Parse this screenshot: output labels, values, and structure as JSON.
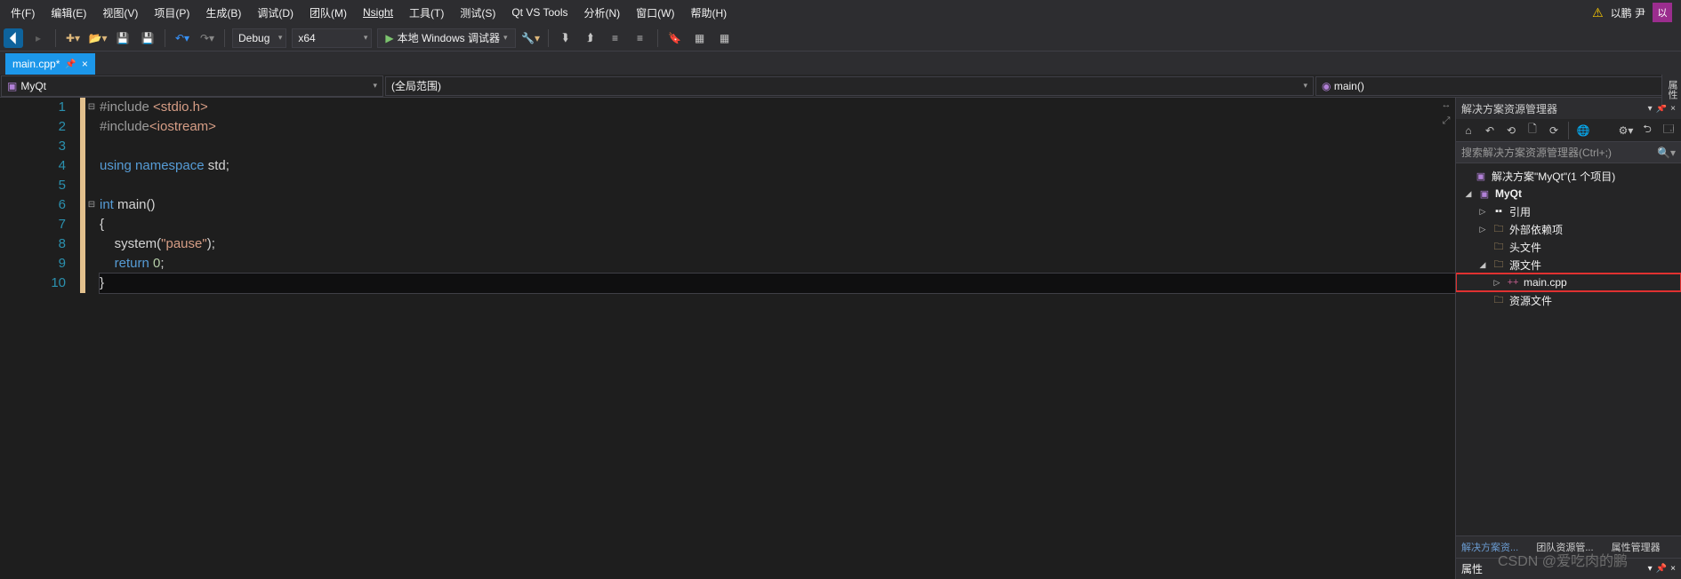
{
  "menu": {
    "file": "件(F)",
    "edit": "编辑(E)",
    "view": "视图(V)",
    "project": "项目(P)",
    "build": "生成(B)",
    "debug": "调试(D)",
    "team": "团队(M)",
    "nsight": "Nsight",
    "tools": "工具(T)",
    "test": "测试(S)",
    "qt": "Qt VS Tools",
    "analyze": "分析(N)",
    "window": "窗口(W)",
    "help": "帮助(H)"
  },
  "user": {
    "name": "以鹏 尹",
    "initial": "以"
  },
  "toolbar": {
    "config": "Debug",
    "platform": "x64",
    "debugger": "本地 Windows 调试器"
  },
  "tabs": {
    "active": "main.cpp*"
  },
  "navbar": {
    "project": "MyQt",
    "scope": "(全局范围)",
    "func": "main()"
  },
  "code": {
    "lines": [
      "#include <stdio.h>",
      "#include<iostream>",
      "",
      "using namespace std;",
      "",
      "int main()",
      "{",
      "    system(\"pause\");",
      "    return 0;",
      "}"
    ],
    "lineNumbers": [
      "1",
      "2",
      "3",
      "4",
      "5",
      "6",
      "7",
      "8",
      "9",
      "10"
    ]
  },
  "solution": {
    "panelTitle": "解决方案资源管理器",
    "searchPlaceholder": "搜索解决方案资源管理器(Ctrl+;)",
    "root": "解决方案\"MyQt\"(1 个项目)",
    "project": "MyQt",
    "nodes": {
      "refs": "引用",
      "external": "外部依赖项",
      "headers": "头文件",
      "sources": "源文件",
      "maincpp": "main.cpp",
      "resources": "资源文件"
    }
  },
  "panelTabs": {
    "t1": "解决方案资...",
    "t2": "团队资源管...",
    "t3": "属性管理器"
  },
  "props": {
    "title": "属性"
  },
  "watermark": "CSDN @爱吃肉的鹏",
  "vtab": "属性"
}
